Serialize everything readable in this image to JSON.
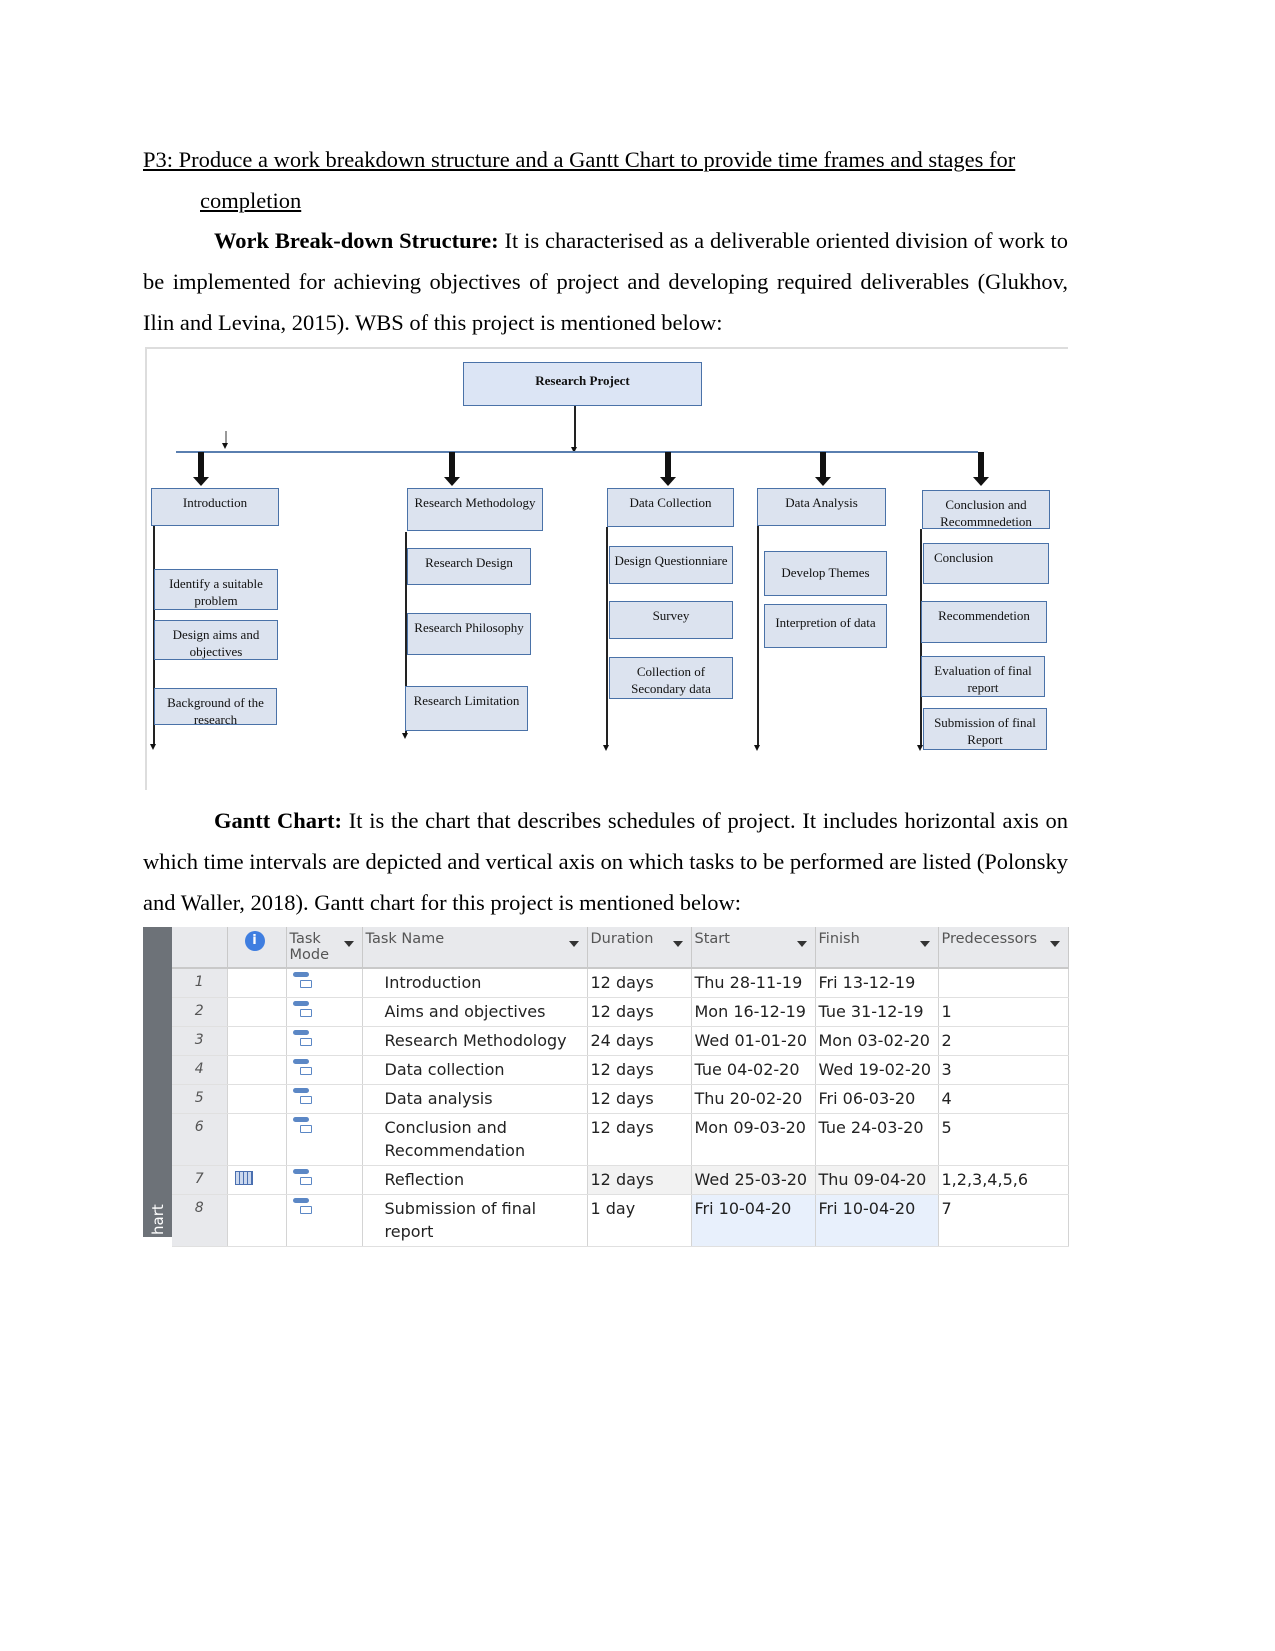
{
  "heading": {
    "line1": "P3: Produce a work breakdown structure and a Gantt Chart to provide time frames and stages for",
    "line2": "completion"
  },
  "wbs_paragraph": {
    "term": "Work Break-down Structure:",
    "text": " It is characterised as a deliverable oriented division of work to be implemented for achieving objectives of project and developing required deliverables (Glukhov, Ilin and Levina, 2015). WBS of this project is mentioned below:"
  },
  "wbs": {
    "root": "Research Project",
    "branches": [
      {
        "label": "Introduction",
        "children": [
          "Identify a suitable problem",
          "Design aims and objectives",
          "Background of the research"
        ]
      },
      {
        "label": "Research Methodology",
        "children": [
          "Research Design",
          "Research Philosophy",
          "Research Limitation"
        ]
      },
      {
        "label": "Data Collection",
        "children": [
          "Design Questionniare",
          "Survey",
          "Collection of Secondary data"
        ]
      },
      {
        "label": "Data Analysis",
        "children": [
          "Develop Themes",
          "Interpretion of data"
        ]
      },
      {
        "label": "Conclusion and Recommnedetion",
        "children": [
          "Conclusion",
          "Recommendetion",
          "Evaluation of final report",
          "Submission of final Report"
        ]
      }
    ]
  },
  "gantt_paragraph": {
    "term": "Gantt Chart:",
    "text": " It is the chart that describes schedules of project. It includes horizontal axis on which time intervals are depicted and vertical axis on which tasks to be performed are listed (Polonsky and Waller, 2018). Gantt chart for this project is mentioned below:"
  },
  "gantt": {
    "side_label": "hart",
    "headers": {
      "info": "i",
      "mode": "Task Mode",
      "name": "Task Name",
      "duration": "Duration",
      "start": "Start",
      "finish": "Finish",
      "predecessors": "Predecessors"
    },
    "rows": [
      {
        "id": "1",
        "name": "Introduction",
        "duration": "12 days",
        "start": "Thu 28-11-19",
        "finish": "Fri 13-12-19",
        "pred": ""
      },
      {
        "id": "2",
        "name": "Aims and objectives",
        "duration": "12 days",
        "start": "Mon 16-12-19",
        "finish": "Tue 31-12-19",
        "pred": "1"
      },
      {
        "id": "3",
        "name": "Research Methodology",
        "duration": "24 days",
        "start": "Wed 01-01-20",
        "finish": "Mon 03-02-20",
        "pred": "2"
      },
      {
        "id": "4",
        "name": "Data collection",
        "duration": "12 days",
        "start": "Tue 04-02-20",
        "finish": "Wed 19-02-20",
        "pred": "3"
      },
      {
        "id": "5",
        "name": "Data analysis",
        "duration": "12 days",
        "start": "Thu 20-02-20",
        "finish": "Fri 06-03-20",
        "pred": "4"
      },
      {
        "id": "6",
        "name": "Conclusion and Recommendation",
        "duration": "12 days",
        "start": "Mon 09-03-20",
        "finish": "Tue 24-03-20",
        "pred": "5"
      },
      {
        "id": "7",
        "name": "Reflection",
        "duration": "12 days",
        "start": "Wed 25-03-20",
        "finish": "Thu 09-04-20",
        "pred": "1,2,3,4,5,6"
      },
      {
        "id": "8",
        "name": "Submission of final report",
        "duration": "1 day",
        "start": "Fri 10-04-20",
        "finish": "Fri 10-04-20",
        "pred": "7"
      }
    ]
  }
}
